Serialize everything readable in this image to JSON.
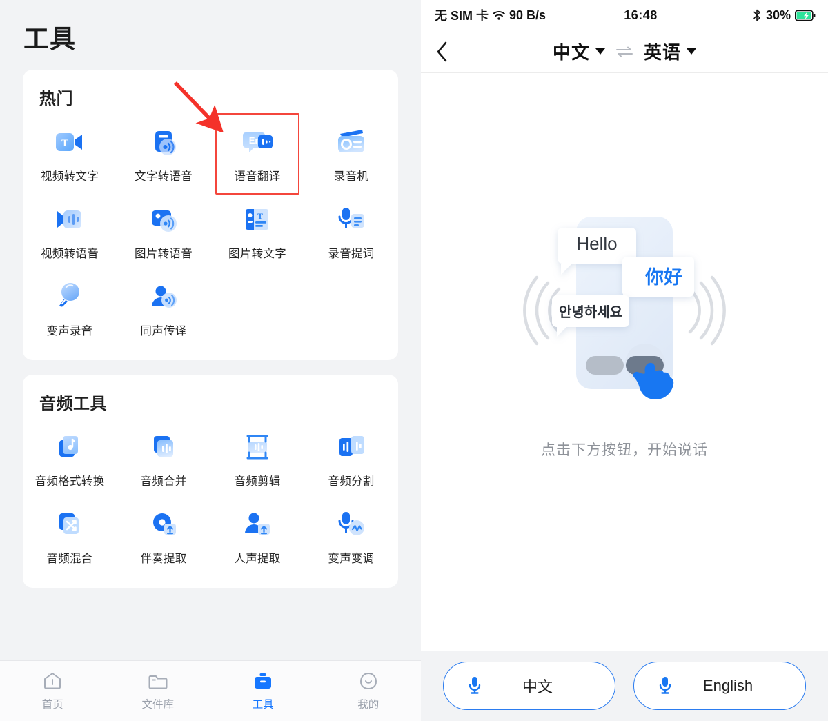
{
  "left": {
    "page_title": "工具",
    "sections": [
      {
        "title": "热门",
        "tools": [
          {
            "label": "视频转文字",
            "icon": "video-to-text-icon"
          },
          {
            "label": "文字转语音",
            "icon": "text-to-speech-icon"
          },
          {
            "label": "语音翻译",
            "icon": "voice-translate-icon",
            "highlighted": true
          },
          {
            "label": "录音机",
            "icon": "recorder-icon"
          },
          {
            "label": "视频转语音",
            "icon": "video-to-speech-icon"
          },
          {
            "label": "图片转语音",
            "icon": "image-to-speech-icon"
          },
          {
            "label": "图片转文字",
            "icon": "image-to-text-icon"
          },
          {
            "label": "录音提词",
            "icon": "recording-teleprompter-icon"
          },
          {
            "label": "变声录音",
            "icon": "voice-change-record-icon"
          },
          {
            "label": "同声传译",
            "icon": "simultaneous-interpretation-icon"
          }
        ]
      },
      {
        "title": "音频工具",
        "tools": [
          {
            "label": "音频格式转换",
            "icon": "audio-format-convert-icon"
          },
          {
            "label": "音频合并",
            "icon": "audio-merge-icon"
          },
          {
            "label": "音频剪辑",
            "icon": "audio-trim-icon"
          },
          {
            "label": "音频分割",
            "icon": "audio-split-icon"
          },
          {
            "label": "音频混合",
            "icon": "audio-mix-icon"
          },
          {
            "label": "伴奏提取",
            "icon": "accompaniment-extract-icon"
          },
          {
            "label": "人声提取",
            "icon": "vocal-extract-icon"
          },
          {
            "label": "变声变调",
            "icon": "pitch-shift-icon"
          }
        ]
      }
    ],
    "tabbar": [
      {
        "label": "首页",
        "icon": "home-icon",
        "active": false
      },
      {
        "label": "文件库",
        "icon": "folder-icon",
        "active": false
      },
      {
        "label": "工具",
        "icon": "toolbox-icon",
        "active": true
      },
      {
        "label": "我的",
        "icon": "profile-icon",
        "active": false
      }
    ],
    "annotation": {
      "box_color": "#f4463c",
      "arrow_color": "#f4322a"
    }
  },
  "right": {
    "statusbar": {
      "carrier": "无 SIM 卡",
      "wifi_icon": "wifi-icon",
      "network_speed": "90 B/s",
      "time": "16:48",
      "bluetooth_icon": "bluetooth-icon",
      "battery_percent": "30%",
      "battery_icon": "battery-charging-icon"
    },
    "navbar": {
      "back_icon": "chevron-left-icon",
      "source_lang": "中文",
      "swap_icon": "swap-arrows-icon",
      "target_lang": "英语"
    },
    "illustration": {
      "bubble_en": "Hello",
      "bubble_zh": "你好",
      "bubble_ko": "안녕하세요",
      "accent_color": "#1877f2"
    },
    "hint": "点击下方按钮，开始说话",
    "mic_buttons": [
      {
        "label": "中文",
        "icon": "microphone-icon"
      },
      {
        "label": "English",
        "icon": "microphone-icon"
      }
    ]
  }
}
